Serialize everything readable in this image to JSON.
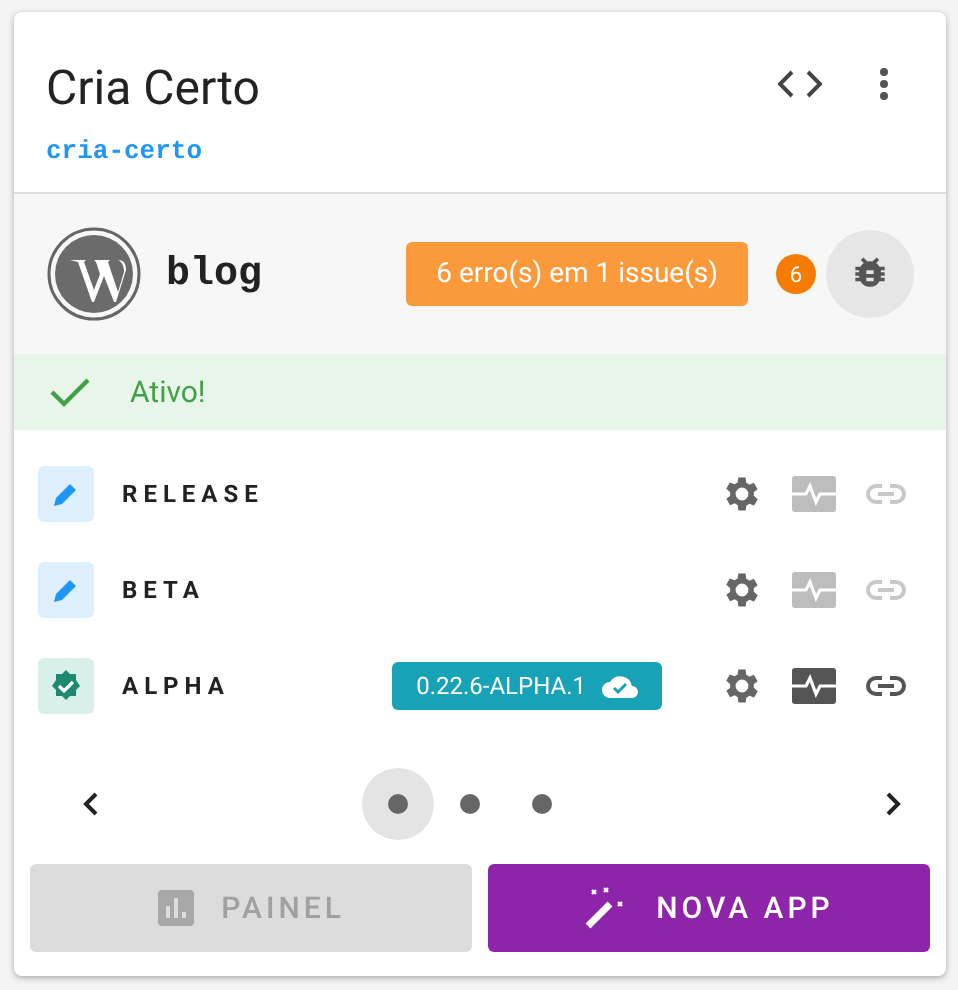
{
  "app": {
    "title": "Cria Certo",
    "slug": "cria-certo"
  },
  "site": {
    "name": "blog",
    "errors_label": "6 erro(s) em 1 issue(s)",
    "error_count": "6"
  },
  "status": {
    "text": "Ativo!",
    "kind": "active"
  },
  "environments": [
    {
      "name": "RELEASE",
      "kind": "draft",
      "monitor_disabled": true,
      "link_disabled": true
    },
    {
      "name": "BETA",
      "kind": "draft",
      "monitor_disabled": true,
      "link_disabled": true
    },
    {
      "name": "ALPHA",
      "kind": "deployed",
      "version": "0.22.6-ALPHA.1",
      "monitor_disabled": false,
      "link_disabled": false
    }
  ],
  "pager": [
    {
      "selected": true
    },
    {
      "selected": false
    },
    {
      "selected": false
    }
  ],
  "buttons": [
    {
      "label": "PAINEL",
      "kind": "dashboard",
      "disabled": true
    },
    {
      "label": "NOVA APP",
      "kind": "new",
      "disabled": false
    }
  ]
}
